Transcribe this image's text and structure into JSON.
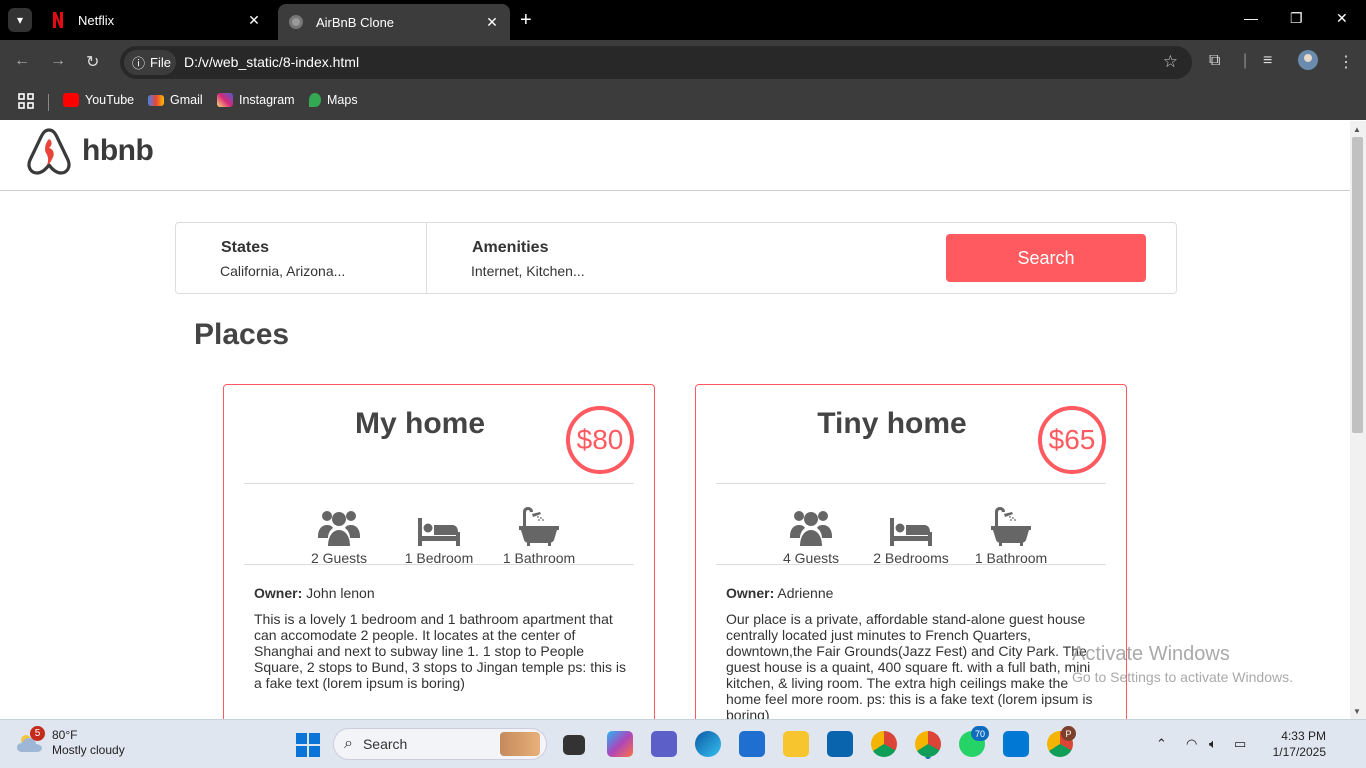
{
  "browser": {
    "tabs": [
      {
        "title": "Netflix",
        "active": false
      },
      {
        "title": "AirBnB Clone",
        "active": true
      }
    ],
    "file_chip": "File",
    "url": "D:/v/web_static/8-index.html",
    "bookmarks": [
      "YouTube",
      "Gmail",
      "Instagram",
      "Maps"
    ]
  },
  "site": {
    "logo_text": "hbnb",
    "filters": {
      "states_title": "States",
      "states_value": "California, Arizona...",
      "amenities_title": "Amenities",
      "amenities_value": "Internet, Kitchen...",
      "search_label": "Search"
    },
    "places_heading": "Places",
    "places": [
      {
        "title": "My home",
        "price": "$80",
        "guests": "2 Guests",
        "bedrooms": "1 Bedroom",
        "bathrooms": "1 Bathroom",
        "owner_label": "Owner:",
        "owner": "John lenon",
        "description": "This is a lovely 1 bedroom and 1 bathroom apartment that can accomodate 2 people. It locates at the center of Shanghai and next to subway line 1. 1 stop to People Square, 2 stops to Bund, 3 stops to Jingan temple ps: this is a fake text (lorem ipsum is boring)"
      },
      {
        "title": "Tiny home",
        "price": "$65",
        "guests": "4 Guests",
        "bedrooms": "2 Bedrooms",
        "bathrooms": "1 Bathroom",
        "owner_label": "Owner:",
        "owner": "Adrienne",
        "description": "Our place is a private, affordable stand-alone guest house centrally located just minutes to French Quarters, downtown,the Fair Grounds(Jazz Fest) and City Park. The guest house is a quaint, 400 square ft. with a full bath, mini kitchen, & living room. The extra high ceilings make the home feel more room. ps: this is a fake text (lorem ipsum is boring)"
      }
    ],
    "accent_color": "#ff5a5f"
  },
  "watermark": {
    "line1": "Activate Windows",
    "line2": "Go to Settings to activate Windows."
  },
  "taskbar": {
    "weather_badge": "5",
    "temperature": "80°F",
    "condition": "Mostly cloudy",
    "search_placeholder": "Search",
    "whatsapp_badge": "70",
    "profile_badge": "P",
    "time": "4:33 PM",
    "date": "1/17/2025"
  }
}
